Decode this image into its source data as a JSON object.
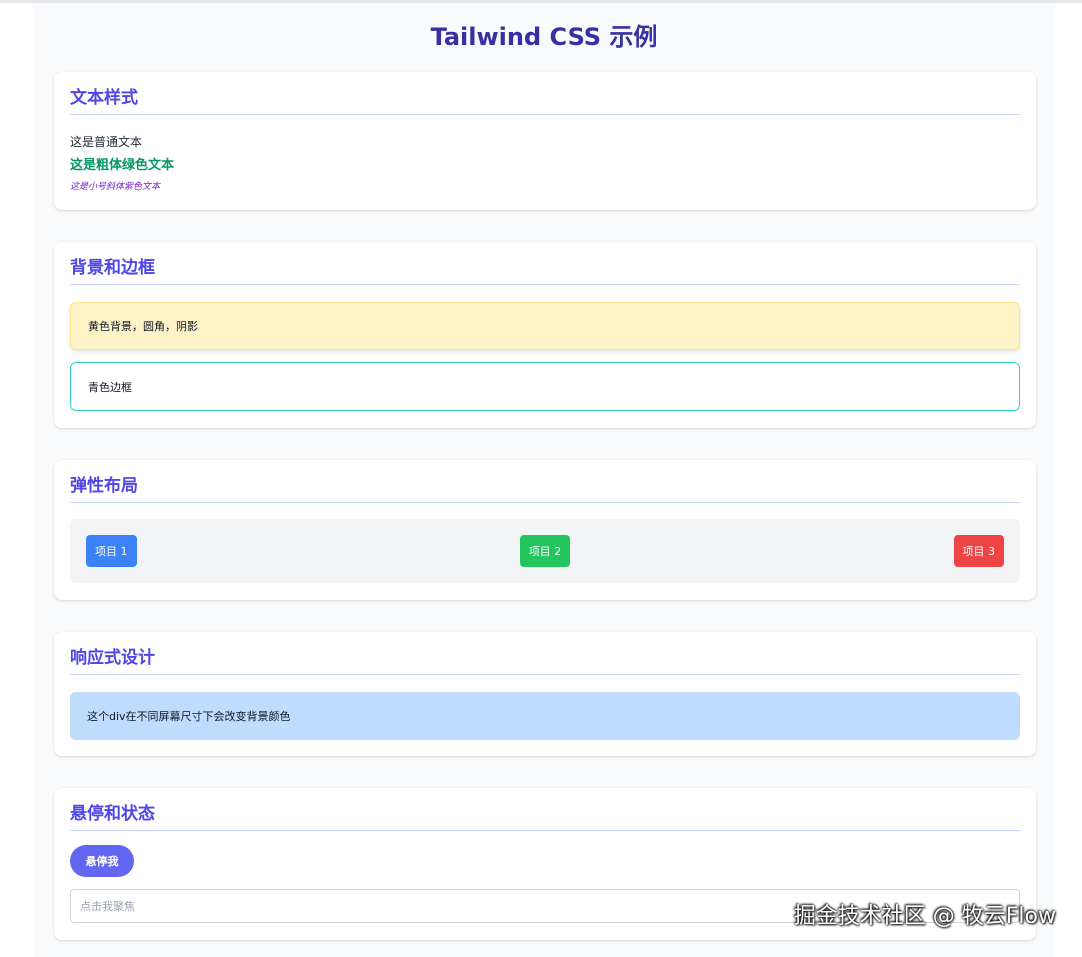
{
  "page": {
    "title": "Tailwind CSS 示例"
  },
  "text_styles": {
    "heading": "文本样式",
    "normal": "这是普通文本",
    "bold_green": "这是粗体绿色文本",
    "small_purple": "这是小号斜体紫色文本"
  },
  "backgrounds": {
    "heading": "背景和边框",
    "yellow_box": "黄色背景，圆角，阴影",
    "teal_box": "青色边框"
  },
  "flex_layout": {
    "heading": "弹性布局",
    "items": [
      {
        "label": "项目 1",
        "color": "#3b82f6"
      },
      {
        "label": "项目 2",
        "color": "#22c55e"
      },
      {
        "label": "项目 3",
        "color": "#ef4444"
      }
    ]
  },
  "responsive": {
    "heading": "响应式设计",
    "box_text": "这个div在不同屏幕尺寸下会改变背景颜色"
  },
  "hover_state": {
    "heading": "悬停和状态",
    "button_label": "悬停我",
    "input_placeholder": "点击我聚焦"
  },
  "watermark": "掘金技术社区 @ 牧云Flow"
}
